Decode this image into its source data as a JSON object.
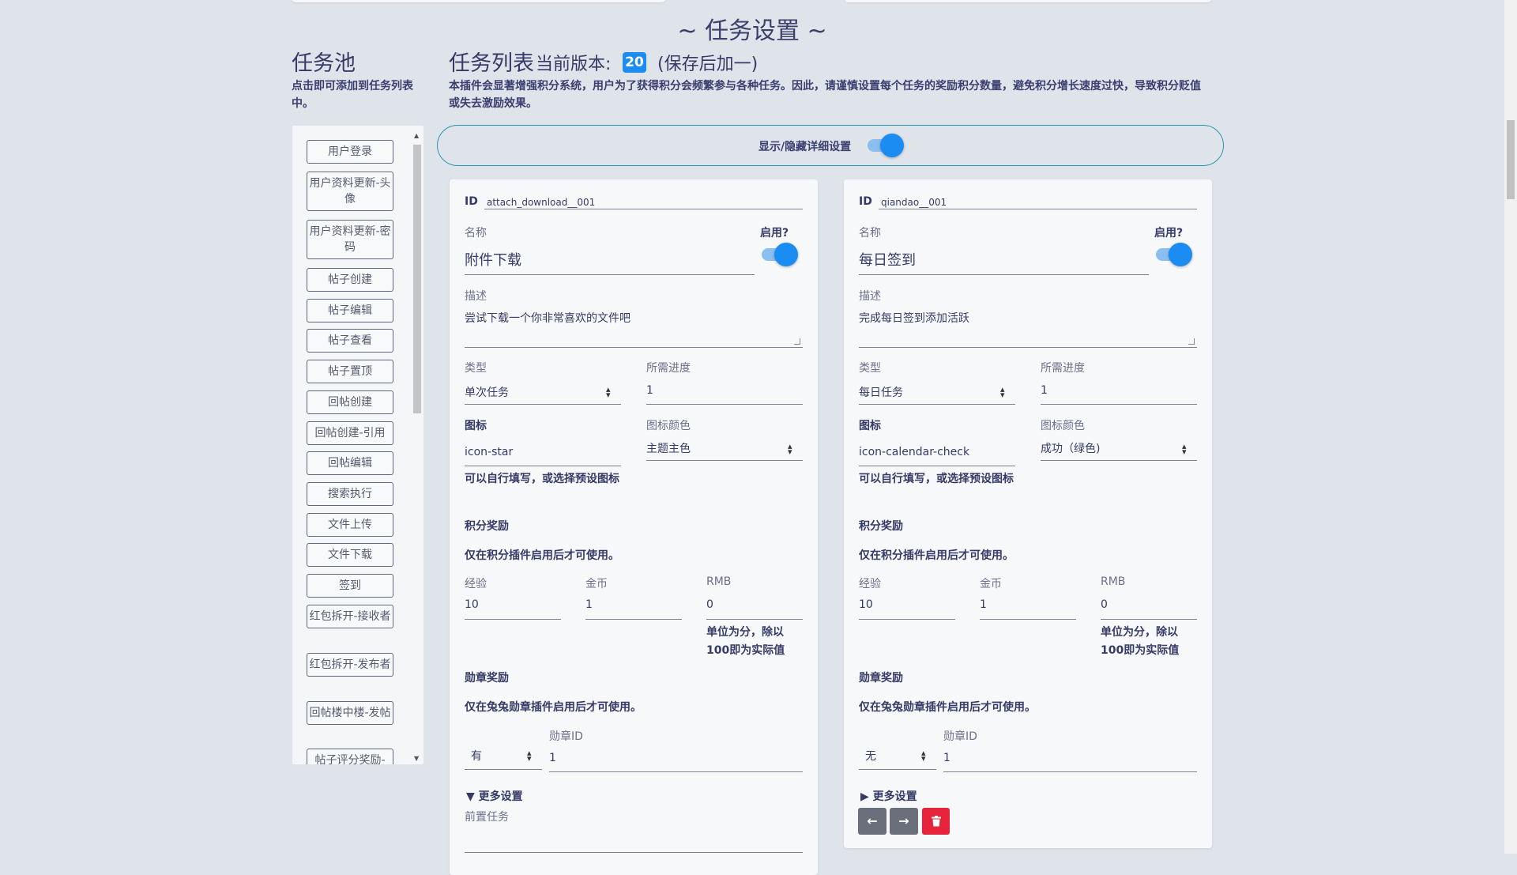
{
  "page_title": "~ 任务设置 ~",
  "pool": {
    "title": "任务池",
    "hint": "点击即可添加到任务列表中。",
    "items": [
      {
        "label": "用户登录"
      },
      {
        "label": "用户资料更新-头像"
      },
      {
        "label": "用户资料更新-密码"
      },
      {
        "label": "帖子创建"
      },
      {
        "label": "帖子编辑"
      },
      {
        "label": "帖子查看"
      },
      {
        "label": "帖子置顶"
      },
      {
        "label": "回帖创建"
      },
      {
        "label": "回帖创建-引用"
      },
      {
        "label": "回帖编辑"
      },
      {
        "label": "搜索执行"
      },
      {
        "label": "文件上传"
      },
      {
        "label": "文件下载"
      },
      {
        "label": "签到"
      },
      {
        "label": "红包拆开-接收者"
      },
      {
        "label": "红包拆开-发布者"
      },
      {
        "label": "回帖楼中楼-发帖"
      },
      {
        "label": "帖子评分奖励-"
      }
    ]
  },
  "list": {
    "title": "任务列表",
    "version_label": "当前版本:",
    "version": "20",
    "version_note": "(保存后加一)",
    "intro": "本插件会显著增强积分系统，用户为了获得积分会频繁参与各种任务。因此，请谨慎设置每个任务的奖励积分数量，避免积分增长速度过快，导致积分贬值或失去激励效果。"
  },
  "detail_toggle": {
    "label": "显示/隐藏详细设置",
    "on": true
  },
  "labels": {
    "id": "ID",
    "name": "名称",
    "enabled": "启用?",
    "desc": "描述",
    "type": "类型",
    "progress": "所需进度",
    "icon": "图标",
    "icon_color": "图标颜色",
    "icon_hint": "可以自行填写，或选择预设图标",
    "points_reward": "积分奖励",
    "points_note": "仅在积分插件启用后才可使用。",
    "exp": "经验",
    "coin": "金币",
    "rmb": "RMB",
    "rmb_hint": "单位为分，除以100即为实际值",
    "badge_reward": "勋章奖励",
    "badge_note": "仅在兔兔勋章插件启用后才可使用。",
    "badge_id": "勋章ID",
    "more": "更多设置",
    "prereq": "前置任务"
  },
  "tasks": [
    {
      "id": "attach_download__001",
      "name": "附件下载",
      "enabled": true,
      "desc": "尝试下载一个你非常喜欢的文件吧",
      "type": "单次任务",
      "progress": "1",
      "icon": "icon-star",
      "icon_color": "主题主色",
      "exp": "10",
      "coin": "1",
      "rmb": "0",
      "badge_enabled": "有",
      "badge_id": "1",
      "more_expanded": true,
      "more_marker": "▼"
    },
    {
      "id": "qiandao__001",
      "name": "每日签到",
      "enabled": true,
      "desc": "完成每日签到添加活跃",
      "type": "每日任务",
      "progress": "1",
      "icon": "icon-calendar-check",
      "icon_color": "成功（绿色)",
      "exp": "10",
      "coin": "1",
      "rmb": "0",
      "badge_enabled": "无",
      "badge_id": "1",
      "more_expanded": false,
      "more_marker": "▶"
    }
  ],
  "icons": {
    "prev": "arrow-left-icon",
    "next": "arrow-right-icon",
    "delete": "trash-icon"
  },
  "colors": {
    "accent": "#1a8cf2",
    "danger": "#e5243b",
    "secondary": "#6a6f7b",
    "outline": "#2c97ad"
  }
}
